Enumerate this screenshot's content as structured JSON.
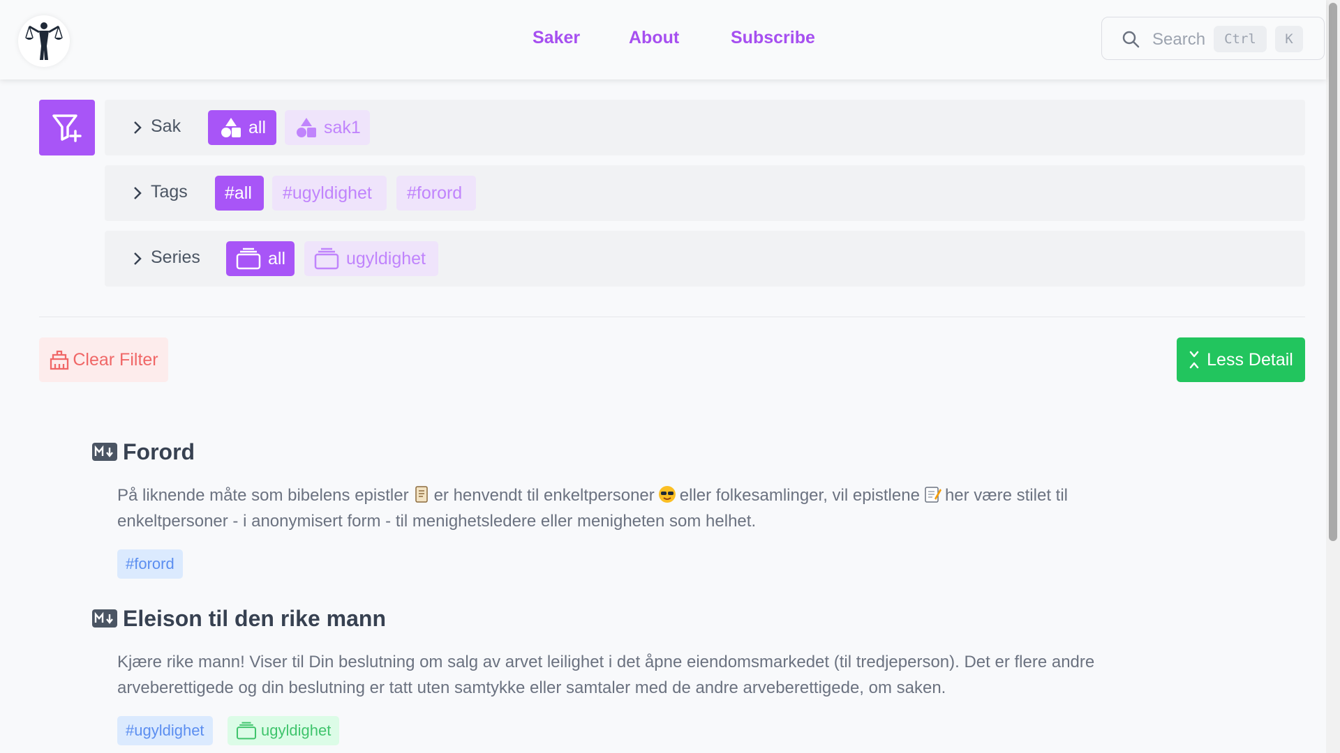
{
  "nav": {
    "links": [
      "Saker",
      "About",
      "Subscribe"
    ]
  },
  "search": {
    "placeholder": "Search",
    "shortcut_keys": [
      "Ctrl",
      "K"
    ]
  },
  "filters": {
    "rows": [
      {
        "label": "Sak",
        "chips": [
          {
            "label": "all",
            "active": true
          },
          {
            "label": "sak1",
            "active": false
          }
        ]
      },
      {
        "label": "Tags",
        "chips": [
          {
            "label": "#all",
            "active": true
          },
          {
            "label": "#ugyldighet",
            "active": false
          },
          {
            "label": "#forord",
            "active": false
          }
        ]
      },
      {
        "label": "Series",
        "chips": [
          {
            "label": "all",
            "active": true
          },
          {
            "label": "ugyldighet",
            "active": false
          }
        ]
      }
    ],
    "clear_label": "Clear Filter",
    "detail_label": "Less Detail"
  },
  "posts": [
    {
      "title": "Forord",
      "text_parts": [
        "På liknende måte som bibelens epistler",
        "er henvendt til enkeltpersoner",
        "eller folkesamlinger, vil epistlene",
        "her være stilet til enkeltpersoner - i anonymisert form - til menighetsledere eller menigheten som helhet."
      ],
      "tags": [
        "#forord"
      ]
    },
    {
      "title": "Eleison til den rike mann",
      "text": "Kjære rike mann! Viser til Din beslutning om salg av arvet leilighet i det åpne eiendomsmarkedet (til tredjeperson). Det er flere andre arveberettigede og din beslutning er tatt uten samtykke eller samtaler med de andre arveberettigede, om saken.",
      "tags": [
        "#ugyldighet"
      ],
      "series": "ugyldighet"
    }
  ],
  "colors": {
    "accent": "#a855f7",
    "accent_text": "#a64ff0",
    "success": "#22c55e",
    "danger": "#f06767"
  },
  "icons": [
    "logo-scales-icon",
    "search-icon",
    "filter-plus-icon",
    "chevron-right-icon",
    "shapes-icon",
    "stack-icon",
    "eraser-icon",
    "collapse-icon",
    "markdown-icon",
    "scroll-emoji",
    "cool-emoji",
    "memo-emoji"
  ]
}
